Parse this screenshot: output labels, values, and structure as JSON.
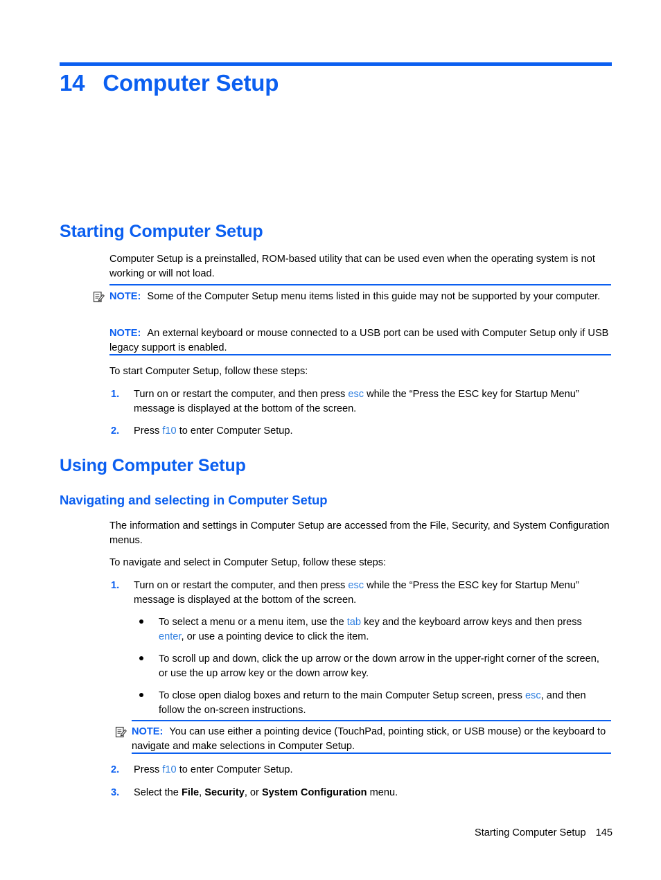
{
  "chapter": {
    "number": "14",
    "title": "Computer Setup"
  },
  "sections": {
    "starting": {
      "heading": "Starting Computer Setup",
      "intro": "Computer Setup is a preinstalled, ROM-based utility that can be used even when the operating system is not working or will not load.",
      "note1": {
        "label": "NOTE:",
        "text": "Some of the Computer Setup menu items listed in this guide may not be supported by your computer.",
        "icon": "note-pencil-icon"
      },
      "note2": {
        "label": "NOTE:",
        "text": "An external keyboard or mouse connected to a USB port can be used with Computer Setup only if USB legacy support is enabled."
      },
      "lead_in": "To start Computer Setup, follow these steps:",
      "steps": [
        {
          "number": "1.",
          "parts": [
            {
              "t": "Turn on or restart the computer, and then press "
            },
            {
              "t": "esc",
              "style": "key"
            },
            {
              "t": " while the “Press the ESC key for Startup Menu” message is displayed at the bottom of the screen."
            }
          ]
        },
        {
          "number": "2.",
          "parts": [
            {
              "t": "Press "
            },
            {
              "t": "f10",
              "style": "key"
            },
            {
              "t": " to enter Computer Setup."
            }
          ]
        }
      ]
    },
    "using": {
      "heading": "Using Computer Setup",
      "subheading": "Navigating and selecting in Computer Setup",
      "intro": "The information and settings in Computer Setup are accessed from the File, Security, and System Configuration menus.",
      "lead_in": "To navigate and select in Computer Setup, follow these steps:",
      "step1": {
        "number": "1.",
        "parts": [
          {
            "t": "Turn on or restart the computer, and then press "
          },
          {
            "t": "esc",
            "style": "key"
          },
          {
            "t": " while the “Press the ESC key for Startup Menu” message is displayed at the bottom of the screen."
          }
        ]
      },
      "bullets": [
        {
          "parts": [
            {
              "t": "To select a menu or a menu item, use the "
            },
            {
              "t": "tab",
              "style": "key"
            },
            {
              "t": " key and the keyboard arrow keys and then press "
            },
            {
              "t": "enter",
              "style": "key"
            },
            {
              "t": ", or use a pointing device to click the item."
            }
          ]
        },
        {
          "parts": [
            {
              "t": "To scroll up and down, click the up arrow or the down arrow in the upper-right corner of the screen, or use the up arrow key or the down arrow key."
            }
          ]
        },
        {
          "parts": [
            {
              "t": "To close open dialog boxes and return to the main Computer Setup screen, press "
            },
            {
              "t": "esc",
              "style": "key"
            },
            {
              "t": ", and then follow the on-screen instructions."
            }
          ]
        }
      ],
      "note3": {
        "label": "NOTE:",
        "text": "You can use either a pointing device (TouchPad, pointing stick, or USB mouse) or the keyboard to navigate and make selections in Computer Setup.",
        "icon": "note-pencil-icon"
      },
      "step2": {
        "number": "2.",
        "parts": [
          {
            "t": "Press "
          },
          {
            "t": "f10",
            "style": "key"
          },
          {
            "t": " to enter Computer Setup."
          }
        ]
      },
      "step3": {
        "number": "3.",
        "parts": [
          {
            "t": "Select the "
          },
          {
            "t": "File",
            "style": "bold"
          },
          {
            "t": ", "
          },
          {
            "t": "Security",
            "style": "bold"
          },
          {
            "t": ", or "
          },
          {
            "t": "System Configuration",
            "style": "bold"
          },
          {
            "t": " menu."
          }
        ]
      }
    }
  },
  "footer": {
    "title": "Starting Computer Setup",
    "page": "145"
  },
  "colors": {
    "accent_blue": "#0b5ff0",
    "key_blue": "#2f7fe0",
    "text": "#000000",
    "background": "#ffffff"
  }
}
